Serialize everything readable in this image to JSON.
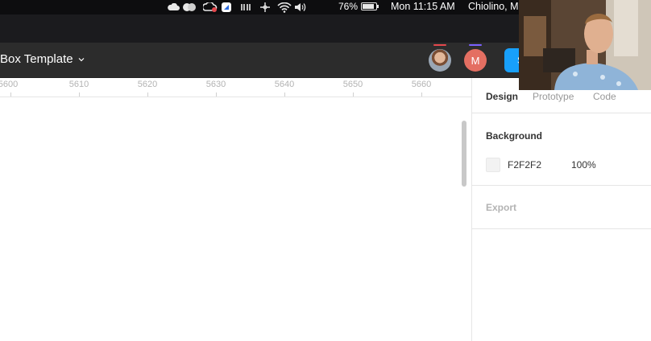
{
  "menubar": {
    "icons": [
      "cloud-icon",
      "faces-icon",
      "creative-cloud-icon",
      "bolt-app-icon",
      "sync-icon",
      "move-icon",
      "wifi-icon",
      "volume-icon"
    ],
    "battery_percent": "76%",
    "battery_level": 0.76,
    "clock": "Mon 11:15 AM",
    "user": "Chiolino, M"
  },
  "toolbar": {
    "file_name": "Box Template",
    "collaborators": [
      {
        "type": "photo",
        "initial": "",
        "presence_color": "#e5484d"
      },
      {
        "type": "letter",
        "initial": "M",
        "presence_color": "#7b61ff"
      }
    ],
    "share_label": "S"
  },
  "ruler": {
    "ticks": [
      "5600",
      "5610",
      "5620",
      "5630",
      "5640",
      "5650",
      "5660"
    ]
  },
  "panel": {
    "tabs": [
      "Design",
      "Prototype",
      "Code"
    ],
    "active_tab": "Design",
    "background": {
      "title": "Background",
      "hex": "F2F2F2",
      "opacity": "100%"
    },
    "export": {
      "title": "Export"
    }
  },
  "colors": {
    "accent": "#18a0fb",
    "toolbar_bg": "#2c2c2c",
    "canvas_bg": "#ffffff"
  }
}
